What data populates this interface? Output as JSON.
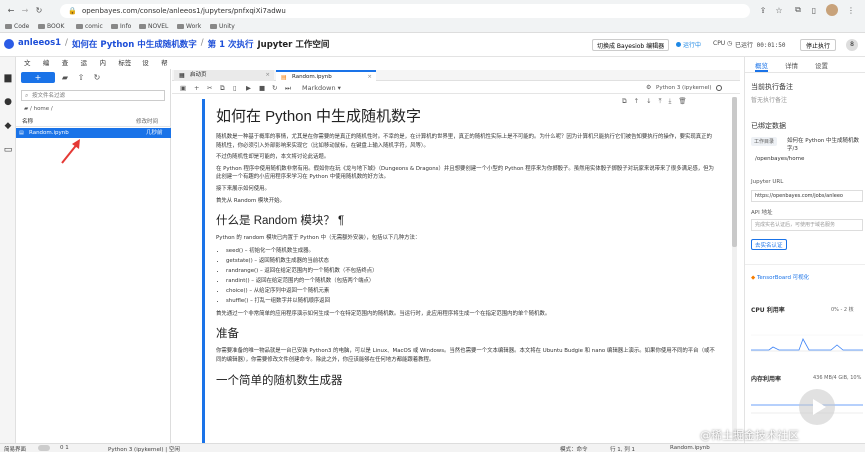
{
  "browser": {
    "url": "openbayes.com/console/anleeos1/jupyters/pnfxqiXi7adwu",
    "bookmarks": [
      "Code",
      "BOOK",
      "comic",
      "Info",
      "NOVEL",
      "Work",
      "Unity"
    ]
  },
  "header": {
    "user": "anleeos1",
    "sep1": "/",
    "project": "如何在 Python 中生成随机数字",
    "sep2": "/",
    "run": "第 1 次执行",
    "workspace": "Jupyter 工作空间",
    "switch_button": "切换成 Bayesiob 编辑器",
    "status_running": "运行中",
    "cpu_label": "CPU",
    "elapsed": "已运行 00:01:50",
    "stop_button": "停止执行",
    "avatar_count": "8"
  },
  "menu": [
    "文件",
    "编辑",
    "查看",
    "运行",
    "内核",
    "标签页",
    "设置",
    "帮助"
  ],
  "filepanel": {
    "new_label": "+",
    "filter_placeholder": "按文件名过滤",
    "path": "/ home /",
    "col_name": "名称",
    "col_modified": "修改时间",
    "files": [
      {
        "name": "Random.ipynb",
        "modified": "几秒前"
      }
    ]
  },
  "tabs": [
    {
      "label": "启动页"
    },
    {
      "label": "Random.ipynb"
    }
  ],
  "toolbar": {
    "cell_type": "Markdown",
    "kernel": "Python 3 (ipykernel)"
  },
  "notebook": {
    "h1": "如何在 Python 中生成随机数字",
    "p1": "随机数是一种基于概率的事情，尤其是在你需要的是真正的随机性时。不幸的是，在计算机的世界里，真正的随机性实际上是不可能的。为什么呢？因为计算机只能执行它们被告知要执行的操作，要实现真正的随机性，你必须引入外部影响来实现它（比如移动鼠标，在键盘上输入随机字符，风等）。",
    "p2": "不过伪随机性却是可能的，本文将讨论此话题。",
    "p3": "在 Python 程序中使用随机数非常有用。假如你在玩《龙与地下城》（Dungeons & Dragons）并且想要创建一个小型的 Python 程序来为你掷骰子。虽然用实体骰子掷骰子对玩家来说带来了很多满足感，但为此创建一个有趣的小应用程序来学习在 Python 中使用随机数的好方法。",
    "p4": "接下来展示如何使用。",
    "p5": "首先从 Random 模块开始。",
    "h2a": "什么是 Random 模块？ ¶",
    "p6": "Python 的 random 模块已内置于 Python 中（无需额外安装），包括以下几种方法：",
    "list": [
      "seed() – 初始化一个随机数生成器。",
      "getstate() – 返回随机数生成器的当前状态",
      "randrange() – 返回在给定范围内的一个随机数（不包括终点）",
      "randint() – 返回在给定范围内的一个随机数（包括两个端点）",
      "choice() – 从给定序列中返回一个随机元素",
      "shuffle() – 打乱一组数字并以随机顺序返回"
    ],
    "p7": "首先通过一个非常简单的应用程序演示如何生成一个在特定范围内的随机数。当运行时，此应用程序将生成一个在指定范围内的单个随机数。",
    "h2b": "准备",
    "p8": "你需要准备的唯一物品就是一台已安装 Python3 的电脑，可以是 Linux、MacOS 或 Windows。当然也需要一个文本编辑器。本文将在 Ubuntu Budgie 和 nano 编辑器上演示。如果你使用不同的平台（或不同的编辑器），你需要修改文件创建命令。除此之外，你应该能够在任何地方都能跟着教程。",
    "h2c": "一个简单的随机数生成器"
  },
  "right_panel": {
    "tabs": [
      "概览",
      "详情",
      "设置"
    ],
    "current_note_title": "当前执行备注",
    "current_note_placeholder": "暂无执行备注",
    "bound_data_title": "已绑定数据",
    "workdir_label": "工作目录",
    "workdir_value": "如何在 Python 中生成随机数字/3",
    "mount_path": "/openbayes/home",
    "jupyter_url_label": "Jupyter URL",
    "jupyter_url": "https://openbayes.com/jobs/anleeo",
    "api_label": "API 地址",
    "api_text": "完成实名认证后，可使用于域名服务",
    "verify_button": "去实名认证",
    "tensorboard": "TensorBoard 可视化",
    "cpu_title": "CPU 利用率",
    "cpu_value": "0% - 2 核",
    "mem_title": "内存利用率",
    "mem_value": "436 MB/4 GiB, 10%"
  },
  "status_bar": {
    "simple": "简易界面",
    "counts": "0   1",
    "kernel": "Python 3 (ipykernel) | 空闲",
    "mode": "模式：命令",
    "position": "行 1, 列 1",
    "file": "Random.ipynb"
  },
  "watermark": "@稀土掘金技术社区",
  "colors": {
    "accent": "#1a73e8",
    "brand": "#1d4ed8",
    "arrow": "#e53935",
    "running": "#1e88e5"
  }
}
